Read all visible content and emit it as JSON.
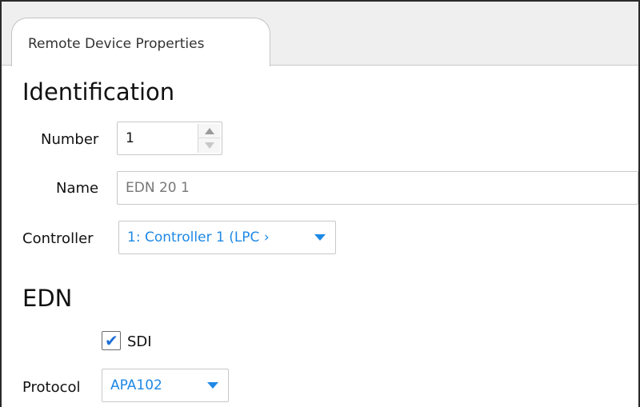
{
  "tab": {
    "label": "Remote Device Properties"
  },
  "identification": {
    "title": "Identification",
    "number": {
      "label": "Number",
      "value": "1"
    },
    "name": {
      "label": "Name",
      "value": "EDN 20 1"
    },
    "controller": {
      "label": "Controller",
      "selected": "1: Controller 1 (LPC ›"
    }
  },
  "edn": {
    "title": "EDN",
    "sdi": {
      "label": "SDI",
      "checked": true
    },
    "protocol": {
      "label": "Protocol",
      "selected": "APA102"
    }
  },
  "colors": {
    "accent": "#1e88e5",
    "tab_bar": "#efefef",
    "border": "#c8c8c8"
  },
  "icons": {
    "spin_up": "triangle-up-icon",
    "spin_down": "triangle-down-icon",
    "dropdown": "chevron-down-icon",
    "check": "checkmark-icon"
  }
}
